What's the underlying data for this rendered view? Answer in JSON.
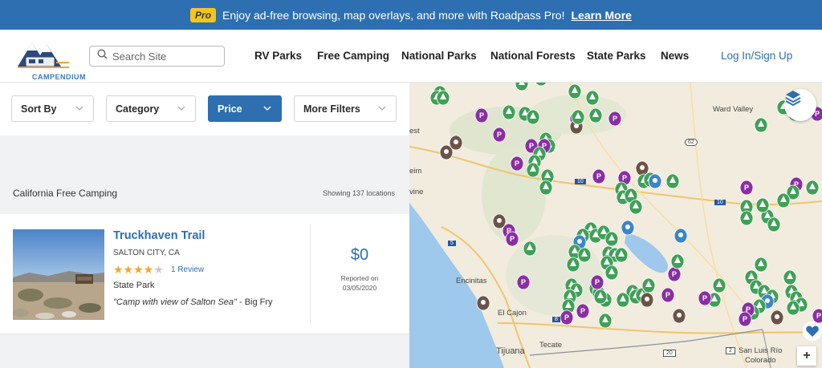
{
  "promo": {
    "badge": "Pro",
    "message": "Enjoy ad-free browsing, map overlays, and more with Roadpass Pro!",
    "link": "Learn More"
  },
  "header": {
    "logo_text": "CAMPENDIUM",
    "search_placeholder": "Search Site",
    "nav": [
      "RV Parks",
      "Free Camping",
      "National Parks",
      "National Forests",
      "State Parks",
      "News"
    ],
    "login": "Log In/Sign Up"
  },
  "filters": {
    "sort_by": "Sort By",
    "category": "Category",
    "price": "Price",
    "more_filters": "More Filters"
  },
  "results": {
    "title": "California Free Camping",
    "count": "Showing 137 locations"
  },
  "listing": {
    "name": "Truckhaven Trail",
    "location": "SALTON CITY, CA",
    "rating": 4,
    "rating_max": 5,
    "reviews": "1 Review",
    "type": "State Park",
    "quote": "\"Camp with view of Salton Sea\"",
    "quote_author": " - Big Fry",
    "price": "$0",
    "reported_label": "Reported on",
    "reported_date": "03/05/2020"
  },
  "map": {
    "labels": {
      "ward_valley": "Ward Valley",
      "encinitas": "Encinitas",
      "el_cajon": "El Cajon",
      "tijuana": "Tijuana",
      "tecate": "Tecate",
      "san_luis_rio": "San Luis Río",
      "colorado": "Colorado",
      "est": "est",
      "eim": "eim",
      "vine": "vine",
      "hwy_62": "62",
      "hwy_10a": "10",
      "hwy_10b": "10",
      "hwy_5": "5",
      "hwy_8": "8",
      "hwy_20": "20",
      "hwy_2": "2"
    },
    "zoom_in": "+",
    "colors": {
      "land": "#f3efe4",
      "water": "#9ec8ec",
      "green_marker": "#3fa057",
      "purple_marker": "#8a2ea3",
      "brown_marker": "#6b5447",
      "blue_marker": "#3b86c8"
    }
  }
}
